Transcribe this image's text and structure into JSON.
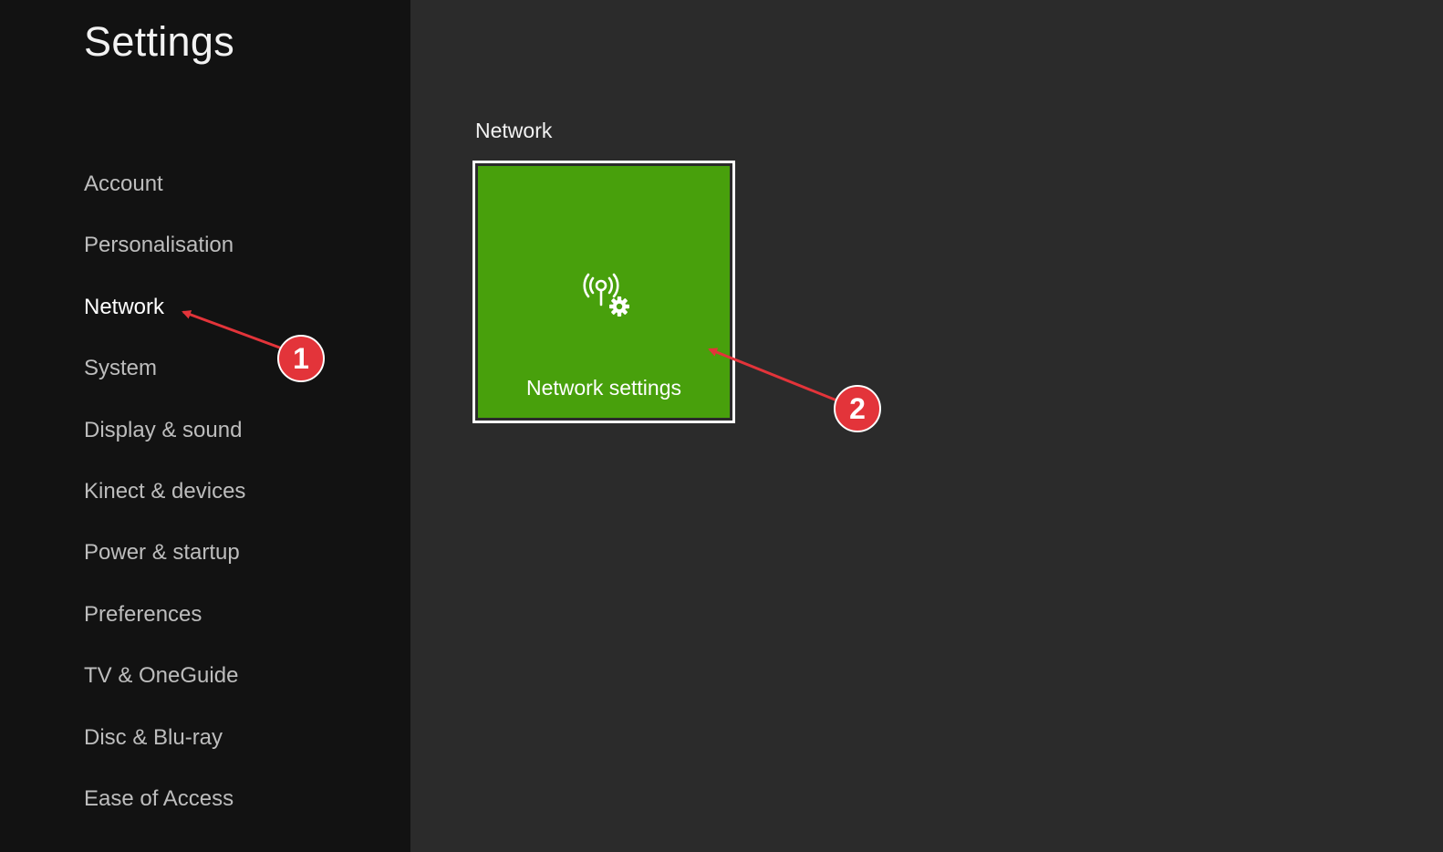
{
  "app": {
    "title": "Settings"
  },
  "sidebar": {
    "items": [
      {
        "label": "Account"
      },
      {
        "label": "Personalisation"
      },
      {
        "label": "Network"
      },
      {
        "label": "System"
      },
      {
        "label": "Display & sound"
      },
      {
        "label": "Kinect & devices"
      },
      {
        "label": "Power & startup"
      },
      {
        "label": "Preferences"
      },
      {
        "label": "TV & OneGuide"
      },
      {
        "label": "Disc & Blu-ray"
      },
      {
        "label": "Ease of Access"
      }
    ],
    "selected": "Network"
  },
  "main": {
    "section_title": "Network",
    "tile": {
      "label": "Network settings",
      "icon": "network-settings-icon"
    }
  },
  "annotations": [
    {
      "number": "1"
    },
    {
      "number": "2"
    }
  ],
  "colors": {
    "tile_green": "#48a00c",
    "callout_red": "#e3343a",
    "sidebar_bg": "#121212",
    "main_bg": "#2b2b2b"
  }
}
